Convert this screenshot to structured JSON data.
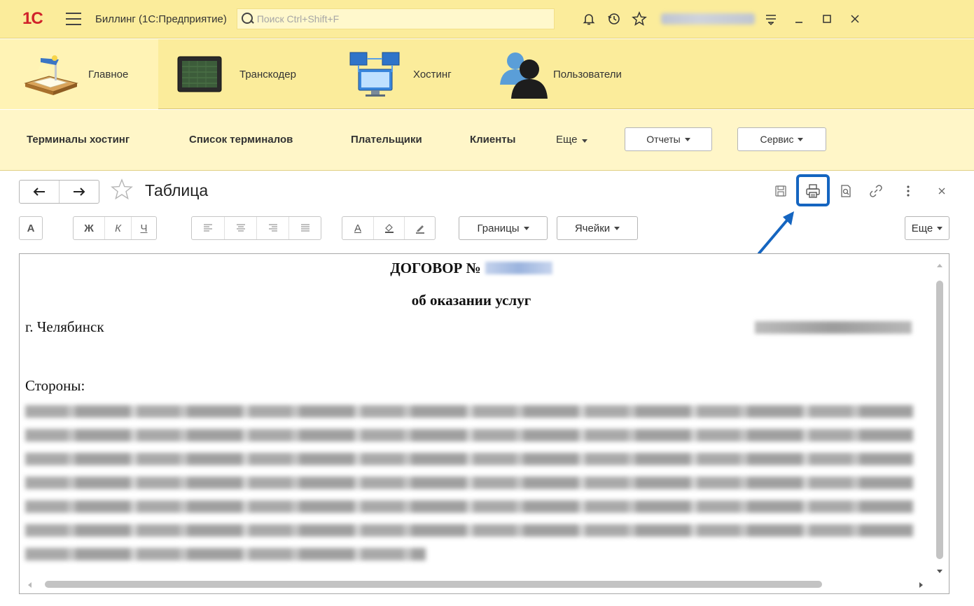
{
  "titlebar": {
    "logo": "1С",
    "app_title": "Биллинг  (1С:Предприятие)",
    "search_placeholder": "Поиск Ctrl+Shift+F",
    "icons": [
      "bell-icon",
      "history-icon",
      "star-icon",
      "menu-lines-icon",
      "minimize-icon",
      "maximize-icon",
      "close-icon"
    ]
  },
  "sections": [
    {
      "label": "Главное",
      "icon": "desk-lamp-icon",
      "active": true
    },
    {
      "label": "Транскодер",
      "icon": "monitor-icon",
      "active": false
    },
    {
      "label": "Хостинг",
      "icon": "network-computers-icon",
      "active": false
    },
    {
      "label": "Пользователи",
      "icon": "users-icon",
      "active": false
    }
  ],
  "function_panel": {
    "links": [
      "Терминалы хостинг",
      "Список терминалов",
      "Плательщики",
      "Клиенты"
    ],
    "more": "Еще",
    "reports": "Отчеты",
    "service": "Сервис"
  },
  "form": {
    "title": "Таблица",
    "header_icons": [
      "save-icon",
      "print-icon",
      "preview-icon",
      "link-icon",
      "more-vertical-icon",
      "close-icon"
    ],
    "highlight_color": "#1565c0"
  },
  "toolbar": {
    "font_button": "А",
    "bold": "Ж",
    "italic": "К",
    "underline": "Ч",
    "text_color": "А",
    "borders": "Границы",
    "cells": "Ячейки",
    "more": "Еще"
  },
  "document": {
    "title_prefix": "ДОГОВОР №",
    "subtitle": "об оказании услуг",
    "city": "г. Челябинск",
    "parties_label": "Стороны:"
  }
}
